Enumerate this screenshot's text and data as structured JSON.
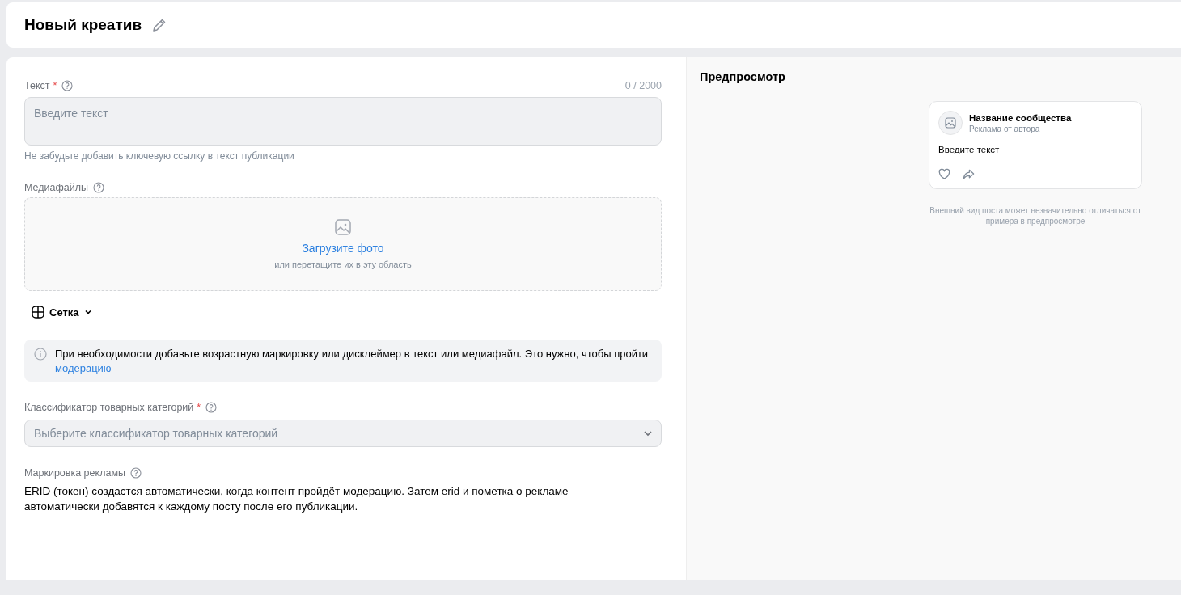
{
  "header": {
    "title": "Новый креатив"
  },
  "text_field": {
    "label": "Текст",
    "required_mark": "*",
    "counter": "0 / 2000",
    "placeholder": "Введите текст",
    "hint": "Не забудьте добавить ключевую ссылку в текст публикации"
  },
  "media": {
    "label": "Медиафайлы",
    "upload_link": "Загрузите фото",
    "upload_hint": "или перетащите их в эту область"
  },
  "layout_dropdown": {
    "label": "Сетка"
  },
  "info": {
    "text": "При необходимости добавьте возрастную маркировку или дисклеймер в текст или медиафайл. Это нужно, чтобы пройти",
    "link": "модерацию"
  },
  "category_select": {
    "label": "Классификатор товарных категорий",
    "required_mark": "*",
    "placeholder": "Выберите классификатор товарных категорий"
  },
  "ad_marking": {
    "label": "Маркировка рекламы",
    "text": "ERID (токен) создастся автоматически, когда контент пройдёт модерацию. Затем erid и пометка о рекламе автоматически добавятся к каждому посту после его публикации."
  },
  "preview": {
    "title": "Предпросмотр",
    "community_name": "Название сообщества",
    "subtitle": "Реклама от автора",
    "post_text": "Введите текст",
    "note": "Внешний вид поста может незначительно отличаться от примера в предпросмотре"
  }
}
